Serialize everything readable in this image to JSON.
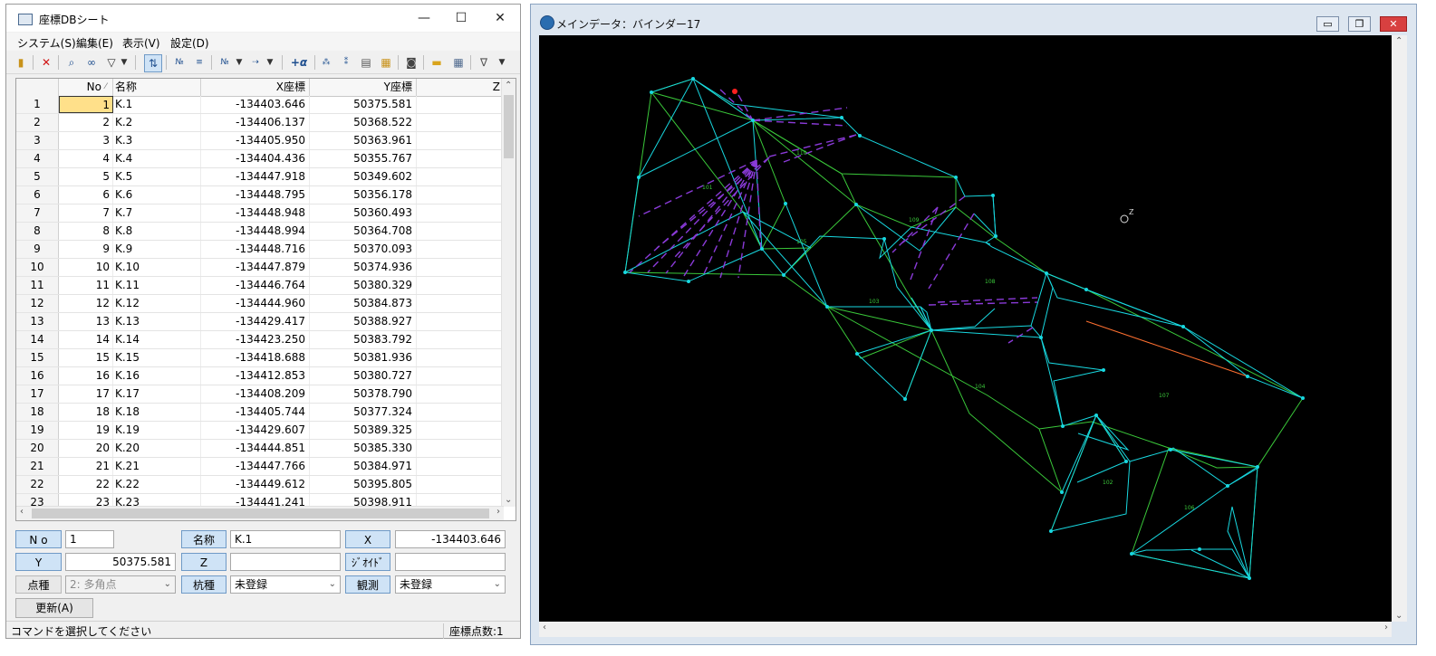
{
  "left_window": {
    "title": "座標DBシート",
    "controls": {
      "minimize": "—",
      "maximize": "☐",
      "close": "✕"
    },
    "menu": [
      "システム(S)",
      "編集(E)",
      "表示(V)",
      "設定(D)"
    ],
    "toolbar_icons": [
      "db-open-icon",
      "delete-icon",
      "search-icon",
      "binoculars-icon",
      "filter-icon",
      "sort-icon",
      "number-icon",
      "number2-icon",
      "renumber-icon",
      "renumber2-icon",
      "plus-alpha-icon",
      "sequence-icon",
      "sequence2-icon",
      "document-icon",
      "report-icon",
      "screenshot-icon",
      "folder-icon",
      "grid-icon",
      "filter2-icon"
    ],
    "toolbar_text": {
      "plus_alpha": "+α",
      "filter_last": "∇"
    },
    "grid": {
      "columns": [
        "",
        "No",
        "名称",
        "X座標",
        "Y座標",
        "Z"
      ],
      "sort_mark": "⁄",
      "rows": [
        [
          "1",
          "1",
          "K.1",
          "-134403.646",
          "50375.581"
        ],
        [
          "2",
          "2",
          "K.2",
          "-134406.137",
          "50368.522"
        ],
        [
          "3",
          "3",
          "K.3",
          "-134405.950",
          "50363.961"
        ],
        [
          "4",
          "4",
          "K.4",
          "-134404.436",
          "50355.767"
        ],
        [
          "5",
          "5",
          "K.5",
          "-134447.918",
          "50349.602"
        ],
        [
          "6",
          "6",
          "K.6",
          "-134448.795",
          "50356.178"
        ],
        [
          "7",
          "7",
          "K.7",
          "-134448.948",
          "50360.493"
        ],
        [
          "8",
          "8",
          "K.8",
          "-134448.994",
          "50364.708"
        ],
        [
          "9",
          "9",
          "K.9",
          "-134448.716",
          "50370.093"
        ],
        [
          "10",
          "10",
          "K.10",
          "-134447.879",
          "50374.936"
        ],
        [
          "11",
          "11",
          "K.11",
          "-134446.764",
          "50380.329"
        ],
        [
          "12",
          "12",
          "K.12",
          "-134444.960",
          "50384.873"
        ],
        [
          "13",
          "13",
          "K.13",
          "-134429.417",
          "50388.927"
        ],
        [
          "14",
          "14",
          "K.14",
          "-134423.250",
          "50383.792"
        ],
        [
          "15",
          "15",
          "K.15",
          "-134418.688",
          "50381.936"
        ],
        [
          "16",
          "16",
          "K.16",
          "-134412.853",
          "50380.727"
        ],
        [
          "17",
          "17",
          "K.17",
          "-134408.209",
          "50378.790"
        ],
        [
          "18",
          "18",
          "K.18",
          "-134405.744",
          "50377.324"
        ],
        [
          "19",
          "19",
          "K.19",
          "-134429.607",
          "50389.325"
        ],
        [
          "20",
          "20",
          "K.20",
          "-134444.851",
          "50385.330"
        ],
        [
          "21",
          "21",
          "K.21",
          "-134447.766",
          "50384.971"
        ],
        [
          "22",
          "22",
          "K.22",
          "-134449.612",
          "50395.805"
        ],
        [
          "23",
          "23",
          "K.23",
          "-134441.241",
          "50398.911"
        ]
      ]
    },
    "form": {
      "no_label": "N o",
      "no_value": "1",
      "name_label": "名称",
      "name_value": "K.1",
      "x_label": "X",
      "x_value": "-134403.646",
      "y_label": "Y",
      "y_value": "50375.581",
      "z_label": "Z",
      "z_value": "",
      "geoid_label": "ｼﾞｵｲﾄﾞ",
      "geoid_value": "",
      "point_type_label": "点種",
      "point_type_value": "2: 多角点",
      "stake_label": "杭種",
      "stake_value": "未登録",
      "obs_label": "観測",
      "obs_value": "未登録",
      "update_button": "更新(A)"
    },
    "status": {
      "message": "コマンドを選択してください",
      "count": "座標点数:1"
    }
  },
  "right_window": {
    "title": "メインデータ：バインダー17",
    "controls": {
      "minimize": "▭",
      "restore": "❐",
      "close": "✕"
    },
    "north_label": "Z",
    "parcel_labels": [
      "101",
      "110",
      "109",
      "105",
      "103",
      "108",
      "104",
      "107",
      "102",
      "106"
    ]
  },
  "colors": {
    "canvas": "#000000",
    "cyan": "#18d8e0",
    "green": "#3ac83a",
    "purple": "#8a3ad8",
    "orange": "#ff7030",
    "red": "#ff2020"
  }
}
